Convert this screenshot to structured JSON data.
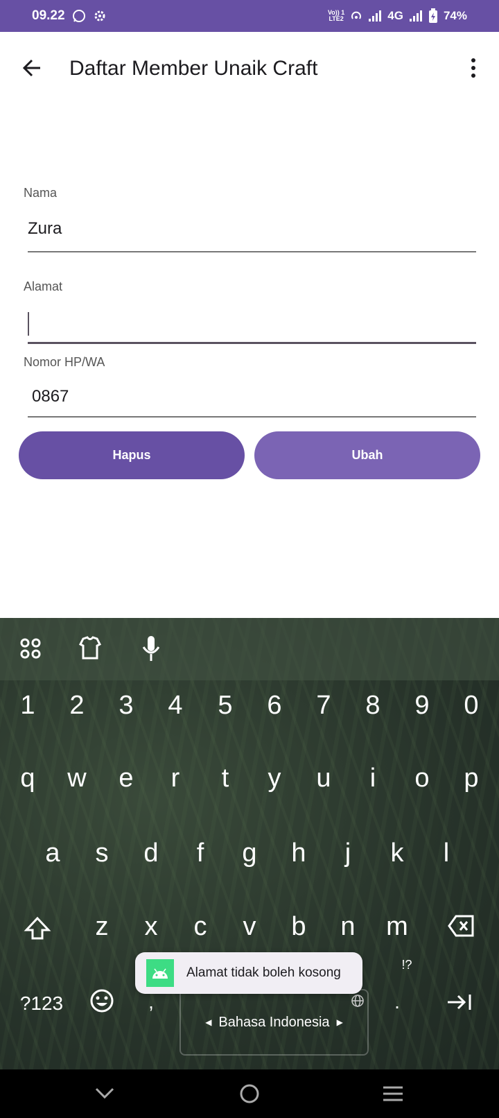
{
  "status_bar": {
    "time": "09.22",
    "network_top": "Vo)) 1",
    "network_bottom": "LTE2",
    "network_type": "4G",
    "battery": "74%"
  },
  "app_bar": {
    "title": "Daftar Member Unaik Craft"
  },
  "form": {
    "nama_label": "Nama",
    "nama_value": "Zura",
    "alamat_label": "Alamat",
    "alamat_value": "",
    "nomor_label": "Nomor HP/WA",
    "nomor_value": "0867"
  },
  "buttons": {
    "hapus": "Hapus",
    "ubah": "Ubah"
  },
  "keyboard": {
    "numbers": [
      "1",
      "2",
      "3",
      "4",
      "5",
      "6",
      "7",
      "8",
      "9",
      "0"
    ],
    "row1": [
      "q",
      "w",
      "e",
      "r",
      "t",
      "y",
      "u",
      "i",
      "o",
      "p"
    ],
    "row2": [
      "a",
      "s",
      "d",
      "f",
      "g",
      "h",
      "j",
      "k",
      "l"
    ],
    "row3": [
      "z",
      "x",
      "c",
      "v",
      "b",
      "n",
      "m"
    ],
    "symbols_key": "?123",
    "comma": ",",
    "period": ".",
    "punct_hint": "!?",
    "language": "Bahasa Indonesia"
  },
  "toast": {
    "message": "Alamat tidak boleh kosong"
  },
  "colors": {
    "primary": "#6750a4",
    "button_secondary": "#7b64b4"
  }
}
